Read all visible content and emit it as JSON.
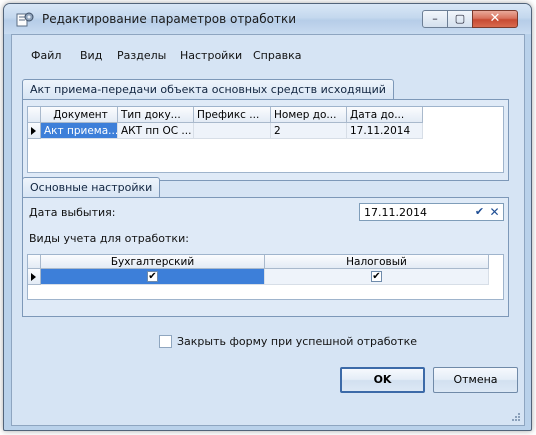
{
  "window": {
    "title": "Редактирование параметров отработки",
    "close_glyph": "✕",
    "min_glyph": "–",
    "max_glyph": "▢"
  },
  "menu": {
    "items": [
      "Файл",
      "Вид",
      "Разделы",
      "Настройки",
      "Справка"
    ]
  },
  "asset_group": {
    "tab_label": "Акт приема-передачи объекта основных средств исходящий",
    "columns": [
      "Документ",
      "Тип доку...",
      "Префикс ...",
      "Номер до...",
      "Дата до..."
    ],
    "rows": [
      [
        "Акт приема...",
        "АКТ пп ОС ...",
        "",
        "2",
        "17.11.2014"
      ]
    ]
  },
  "settings_group": {
    "tab_label": "Основные настройки",
    "disposal_date_label": "Дата выбытия:",
    "disposal_date_value": "17.11.2014",
    "accounting_types_label": "Виды учета для отработки:",
    "accounting_columns": [
      "Бухгалтерский",
      "Налоговый"
    ],
    "accounting_row": [
      true,
      true
    ]
  },
  "close_on_success": {
    "label": "Закрыть форму при успешной отработке",
    "checked": false
  },
  "buttons": {
    "ok": "OK",
    "cancel": "Отмена"
  },
  "icons": {
    "app": "document-gear-icon",
    "date_confirm": "checkmark-icon",
    "date_clear": "close-icon",
    "row_indicator": "triangle-right-icon"
  },
  "colors": {
    "window_frame": "#b9d1ea",
    "client_bg": "#d6e4f4",
    "selection": "#3d7fd9",
    "close_button": "#c74a32"
  }
}
